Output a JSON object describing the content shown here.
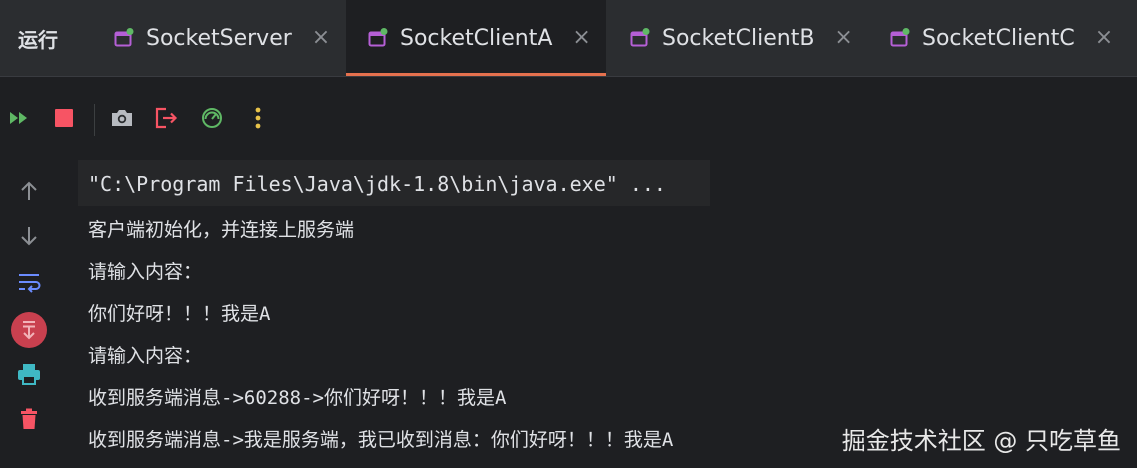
{
  "panel": {
    "title": "运行"
  },
  "tabs": [
    {
      "label": "SocketServer",
      "active": false
    },
    {
      "label": "SocketClientA",
      "active": true
    },
    {
      "label": "SocketClientB",
      "active": false
    },
    {
      "label": "SocketClientC",
      "active": false
    }
  ],
  "toolbar": {
    "icons": [
      "rerun-icon",
      "stop-icon",
      "screenshot-icon",
      "exit-icon",
      "profiler-icon",
      "more-icon"
    ]
  },
  "gutter": {
    "icons": [
      "arrow-up-icon",
      "arrow-down-icon",
      "soft-wrap-icon",
      "scroll-to-end-icon",
      "print-icon",
      "trash-icon"
    ]
  },
  "console": {
    "command": "\"C:\\Program Files\\Java\\jdk-1.8\\bin\\java.exe\" ...",
    "lines": [
      "客户端初始化，并连接上服务端",
      "请输入内容：",
      "你们好呀！！！我是A",
      "请输入内容：",
      "收到服务端消息->60288->你们好呀！！！我是A",
      "收到服务端消息->我是服务端，我已收到消息：你们好呀！！！我是A"
    ]
  },
  "watermark": "掘金技术社区 @ 只吃草鱼",
  "colors": {
    "background": "#1e1f22",
    "tabbar": "#2b2d30",
    "active_tab_underline": "#e5714e",
    "run_green": "#5fb865",
    "stop_red": "#f75464",
    "tab_icon_purple": "#b55fd6"
  }
}
